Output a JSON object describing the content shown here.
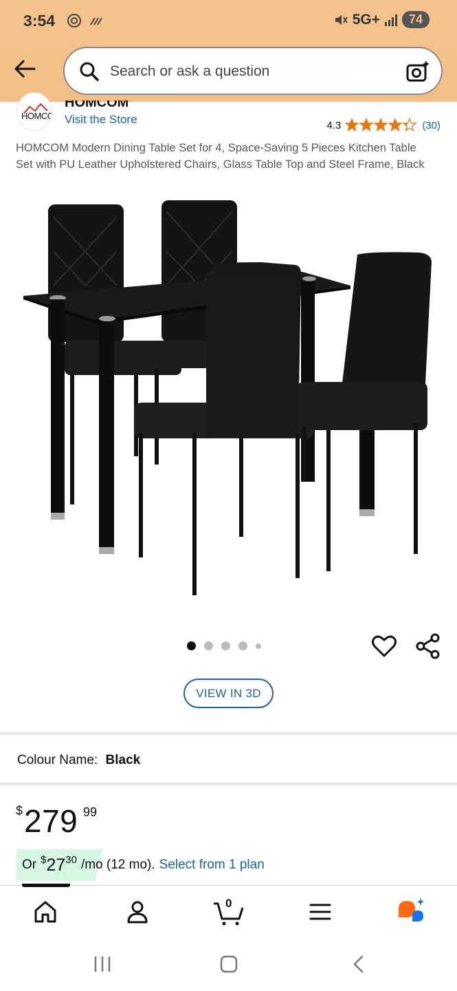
{
  "status_bar": {
    "time": "3:54",
    "network": "5G+",
    "battery": "74"
  },
  "search": {
    "placeholder": "Search or ask a question"
  },
  "store": {
    "logo_text": "HOMCOM",
    "name": "HOMCOM",
    "visit_label": "Visit the Store"
  },
  "rating": {
    "value": "4.3",
    "stars": 4.3,
    "count": "(30)"
  },
  "product": {
    "title": "HOMCOM Modern Dining Table Set for 4, Space-Saving 5 Pieces Kitchen Table Set with PU Leather Upholstered Chairs, Glass Table Top and Steel Frame, Black",
    "image_count": 5,
    "active_image": 1,
    "view_3d_label": "VIEW IN 3D"
  },
  "colour": {
    "label": "Colour Name:",
    "value": "Black"
  },
  "price": {
    "symbol": "$",
    "whole": "279",
    "fraction": "99"
  },
  "monthly": {
    "or": "Or",
    "symbol": "$",
    "whole": "27",
    "fraction": "30",
    "tail": "/mo (12 mo).",
    "link": "Select from 1 plan"
  },
  "bottom_nav": {
    "cart_count": "0",
    "items": [
      "home",
      "account",
      "cart",
      "menu",
      "rufus"
    ]
  },
  "colors": {
    "header": "#f3bf86",
    "link": "#2162a1",
    "star": "#e47911",
    "monthly_bg": "#d6f5e3"
  }
}
